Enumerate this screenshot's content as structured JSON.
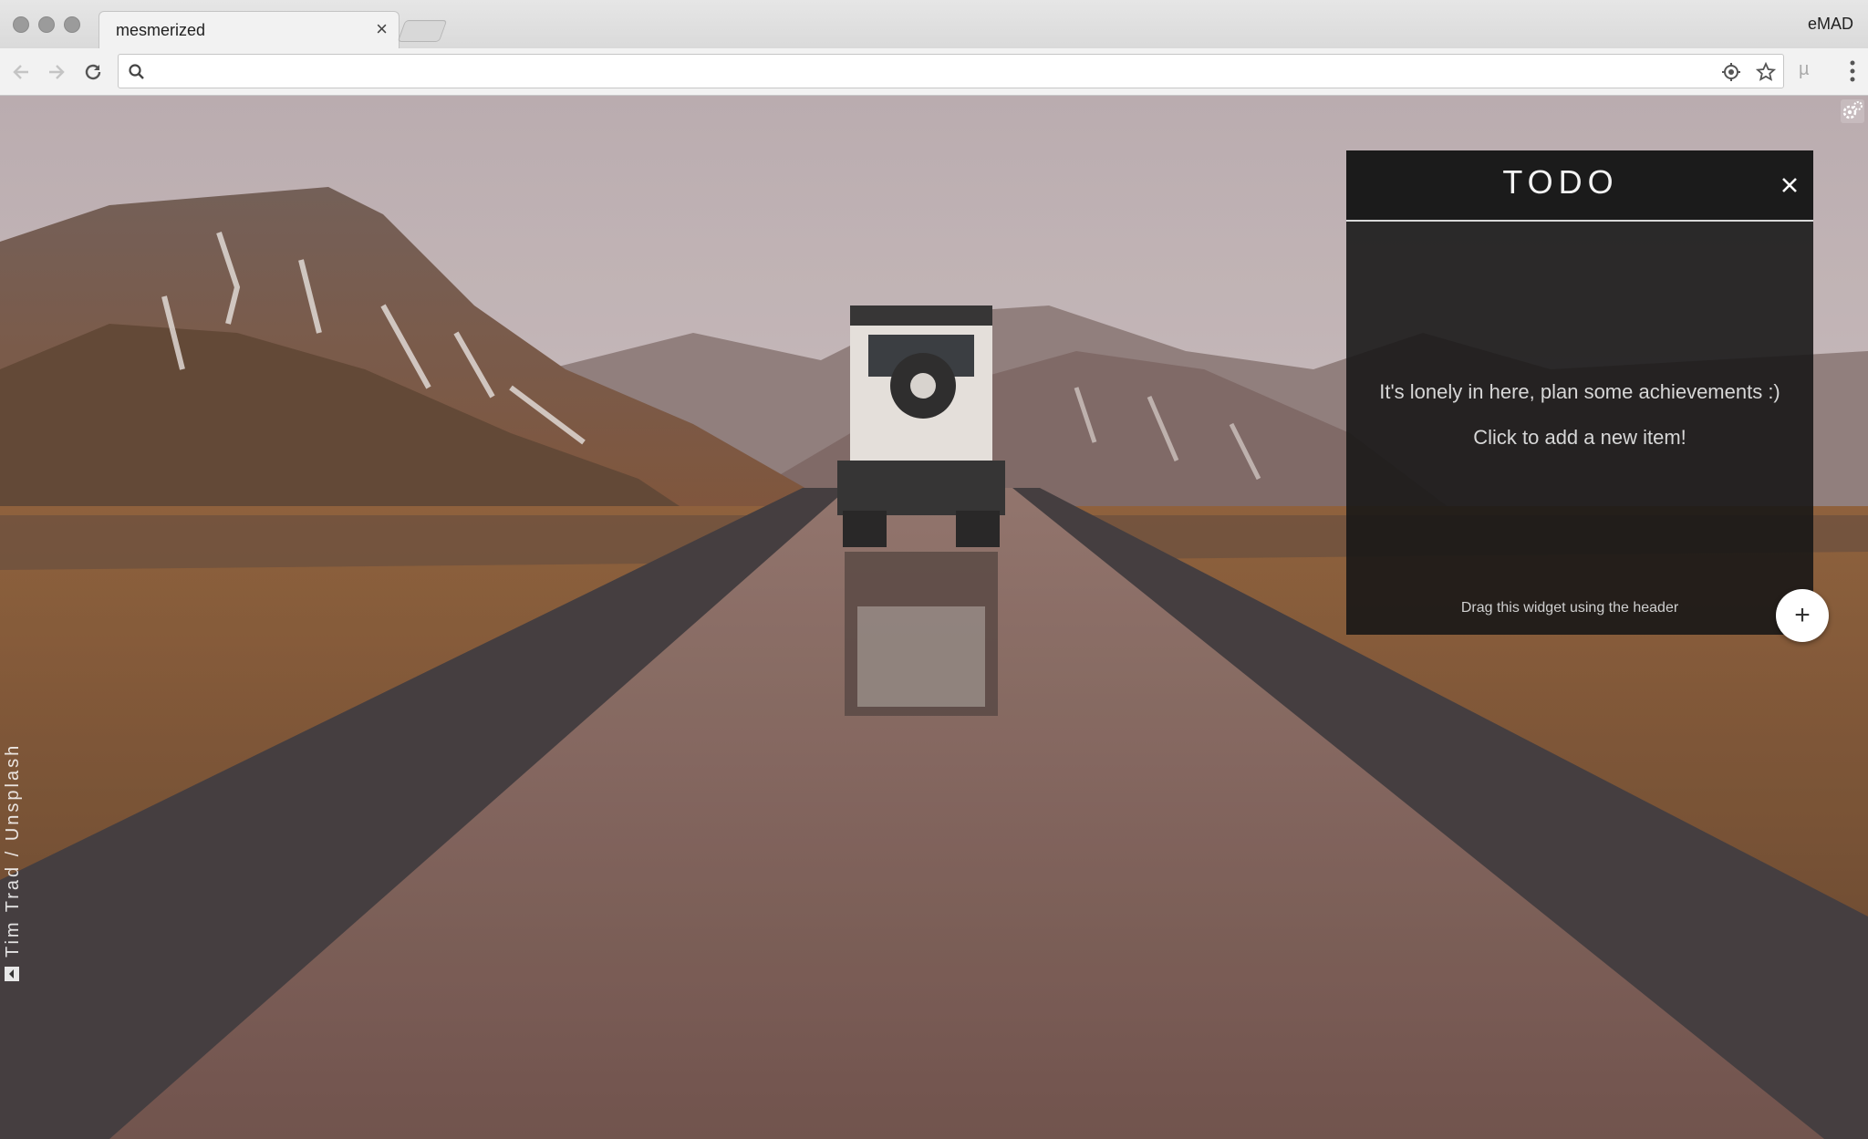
{
  "browser": {
    "tab": {
      "title": "mesmerized",
      "close_glyph": "×"
    },
    "profile_name": "eMAD",
    "omnibox": {
      "value": "",
      "placeholder": ""
    },
    "icons": {
      "back": "arrow-left-icon",
      "forward": "arrow-right-icon",
      "reload": "reload-icon",
      "search": "search-icon",
      "location": "location-target-icon",
      "bookmark": "star-icon",
      "extension": "ublock-icon",
      "menu": "more-vertical-icon"
    }
  },
  "page": {
    "photo_credit": "Tim Trad / Unsplash",
    "settings_icon": "gear-icon"
  },
  "todo_widget": {
    "title": "TODO",
    "empty_message": "It's lonely in here, plan some achievements :)",
    "add_prompt": "Click to add a new item!",
    "drag_hint": "Drag this widget using the header",
    "add_glyph": "+"
  },
  "colors": {
    "widget_bg": "#161616",
    "widget_header_bg": "#1b1b1b",
    "widget_accent_line": "#d8d8d8",
    "chrome_bg": "#f2f2f2"
  }
}
